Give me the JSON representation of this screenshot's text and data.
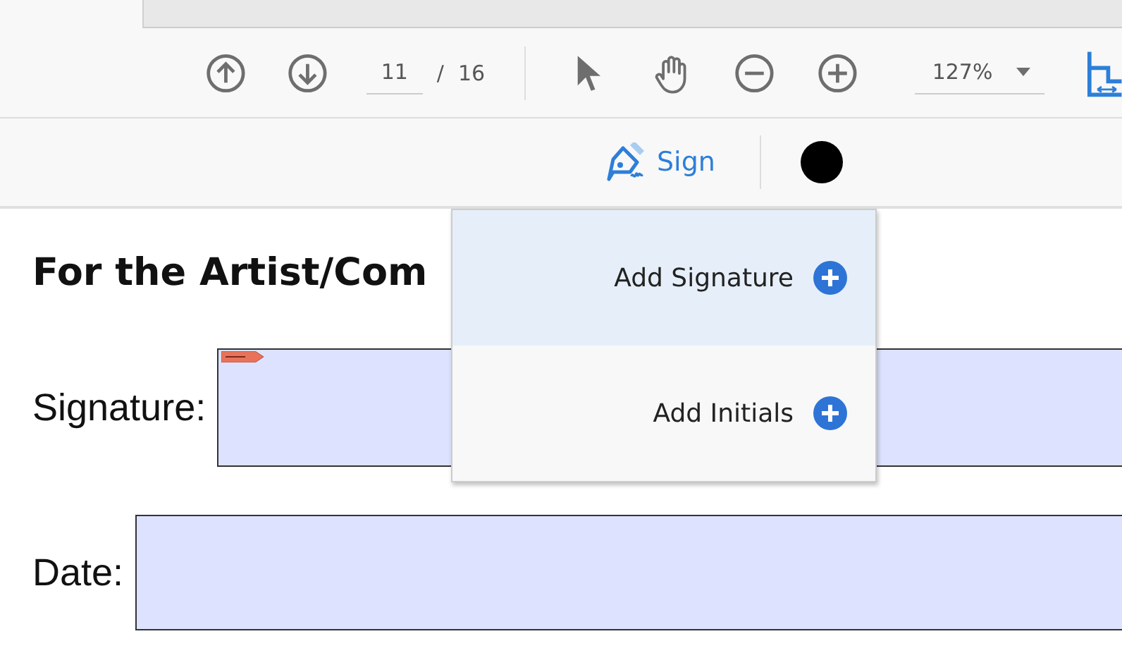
{
  "toolbar": {
    "page_current": "11",
    "page_separator": "/",
    "page_total": "16",
    "zoom": "127%"
  },
  "sign_bar": {
    "sign_label": "Sign",
    "color": "#000000"
  },
  "sign_menu": [
    {
      "label": "Add Signature",
      "selected": true
    },
    {
      "label": "Add Initials",
      "selected": false
    }
  ],
  "document": {
    "heading": "For the Artist/Com",
    "fields": [
      {
        "label": "Signature:",
        "kind": "signature"
      },
      {
        "label": "Date:",
        "kind": "date"
      }
    ]
  }
}
